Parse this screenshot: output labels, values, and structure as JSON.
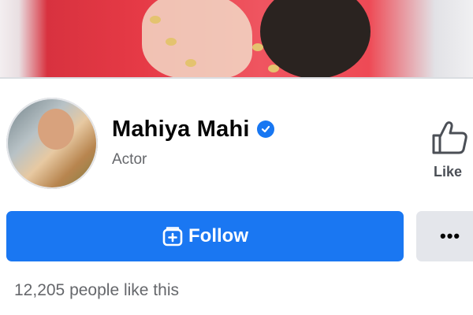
{
  "profile": {
    "name": "Mahiya Mahi",
    "category": "Actor",
    "verified": true
  },
  "actions": {
    "like_label": "Like",
    "follow_label": "Follow",
    "more_icon": "more-options-icon"
  },
  "stats": {
    "likes_text": "12,205 people like this"
  },
  "icons": {
    "verified": "verified-badge-icon",
    "like": "thumbs-up-icon",
    "follow": "follow-icon"
  },
  "colors": {
    "primary": "#1a77f2",
    "secondary_button": "#e4e6eb",
    "text_primary": "#050505",
    "text_secondary": "#65676b"
  }
}
